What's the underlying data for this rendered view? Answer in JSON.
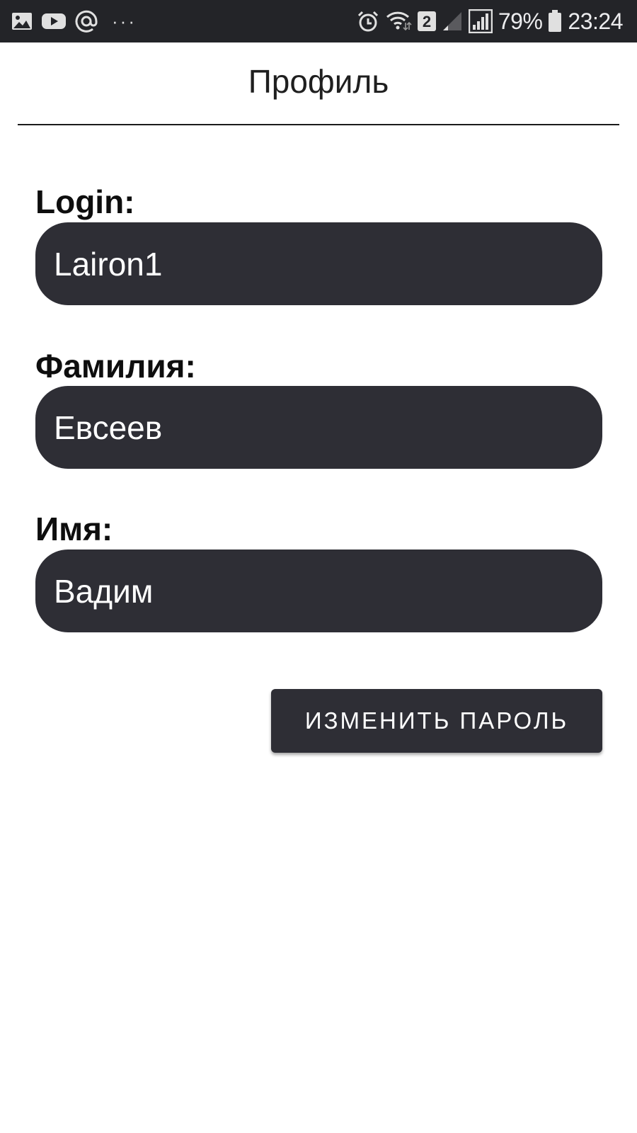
{
  "status_bar": {
    "left_icons": [
      "gallery-icon",
      "youtube-icon",
      "at-sign-icon"
    ],
    "more_indicator": "···",
    "right_icons": [
      "alarm-icon",
      "wifi-icon",
      "sim-2-icon",
      "signal-icon"
    ],
    "sim_badge": "2",
    "battery_percent": "79%",
    "time": "23:24"
  },
  "header": {
    "title": "Профиль"
  },
  "form": {
    "login": {
      "label": "Login:",
      "value": "Lairon1"
    },
    "surname": {
      "label": "Фамилия:",
      "value": "Евсеев"
    },
    "name": {
      "label": "Имя:",
      "value": "Вадим"
    }
  },
  "actions": {
    "change_password_label": "ИЗМЕНИТЬ ПАРОЛЬ"
  },
  "colors": {
    "status_bar_bg": "#232428",
    "field_bg": "#2e2e35",
    "button_bg": "#2e2e35",
    "text_on_dark": "#ffffff"
  }
}
